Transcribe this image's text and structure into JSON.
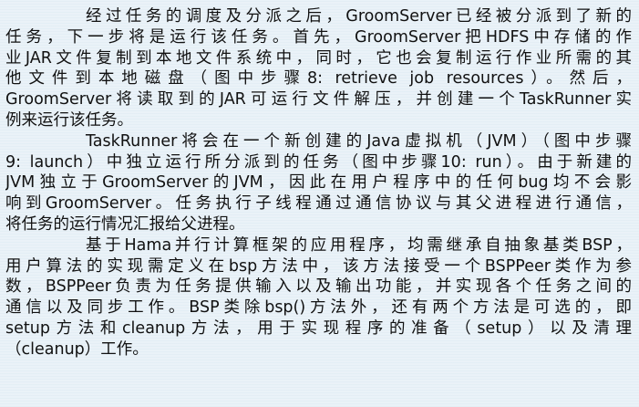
{
  "paragraphs": [
    {
      "lines": [
        "经过任务的调度及分派之后，GroomServer已经被分派到了新的",
        "任务，下一步将是运行该任务。首先，GroomServer把HDFS中存储的作",
        "业JAR文件复制到本地文件系统中，同时，它也会复制运行作业所需的其",
        "他文件到本地磁盘（图中步骤8: retrieve job resources）。然后，",
        "GroomServer将读取到的JAR可运行文件解压，并创建一个TaskRunner实",
        "例来运行该任务。"
      ]
    },
    {
      "lines": [
        "TaskRunner将会在一个新创建的Java虚拟机（JVM）（图中步骤",
        "9: launch）中独立运行所分派到的任务（图中步骤10: run）。由于新建的",
        "JVM独立于GroomServer的JVM，因此在用户程序中的任何bug均不会影",
        "响到GroomServer。任务执行子线程通过通信协议与其父进程进行通信，",
        "将任务的运行情况汇报给父进程。"
      ]
    },
    {
      "lines": [
        "基于Hama并行计算框架的应用程序，均需继承自抽象基类BSP，",
        "用户算法的实现需定义在bsp方法中，该方法接受一个BSPPeer类作为参",
        "数，BSPPeer负责为任务提供输入以及输出功能，并实现各个任务之间的",
        "通信以及同步工作。BSP类除bsp()方法外，还有两个方法是可选的，即",
        "setup方法和cleanup方法，用于实现程序的准备（setup）以及清理",
        "（cleanup）工作。"
      ]
    }
  ]
}
